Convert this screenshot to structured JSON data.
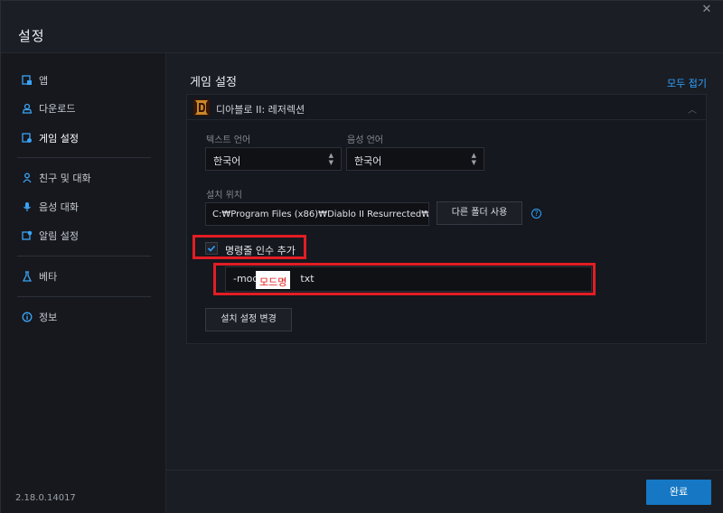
{
  "window": {
    "title": "설정"
  },
  "sidebar": {
    "items": [
      {
        "label": "앱",
        "icon": "app-icon"
      },
      {
        "label": "다운로드",
        "icon": "download-icon"
      },
      {
        "label": "게임 설정",
        "icon": "game-settings-icon",
        "active": true
      },
      {
        "label": "친구 및 대화",
        "icon": "friends-icon"
      },
      {
        "label": "음성 대화",
        "icon": "microphone-icon"
      },
      {
        "label": "알림 설정",
        "icon": "notification-icon"
      },
      {
        "label": "베타",
        "icon": "beta-flask-icon"
      },
      {
        "label": "정보",
        "icon": "info-icon"
      }
    ],
    "version": "2.18.0.14017"
  },
  "main": {
    "section_title": "게임 설정",
    "collapse_all": "모두 접기",
    "game": {
      "name": "디아블로 II: 레저렉션",
      "text_language_label": "텍스트 언어",
      "text_language_value": "한국어",
      "voice_language_label": "음성 언어",
      "voice_language_value": "한국어",
      "install_location_label": "설치 위치",
      "install_path": "C:₩Program Files (x86)₩Diablo II Resurrected₩",
      "use_other_folder": "다른 폴더 사용",
      "help": "?",
      "cmd_args_label": "명령줄 인수 추가",
      "cmd_args_checked": true,
      "cmd_args_prefix": "-mod",
      "cmd_args_suffix": "txt",
      "mask_text": "모드명",
      "change_install": "설치 설정 변경"
    }
  },
  "footer": {
    "done": "완료"
  },
  "colors": {
    "accent": "#2fa4ff",
    "primary_button": "#1678c4",
    "highlight": "#e21d24"
  }
}
